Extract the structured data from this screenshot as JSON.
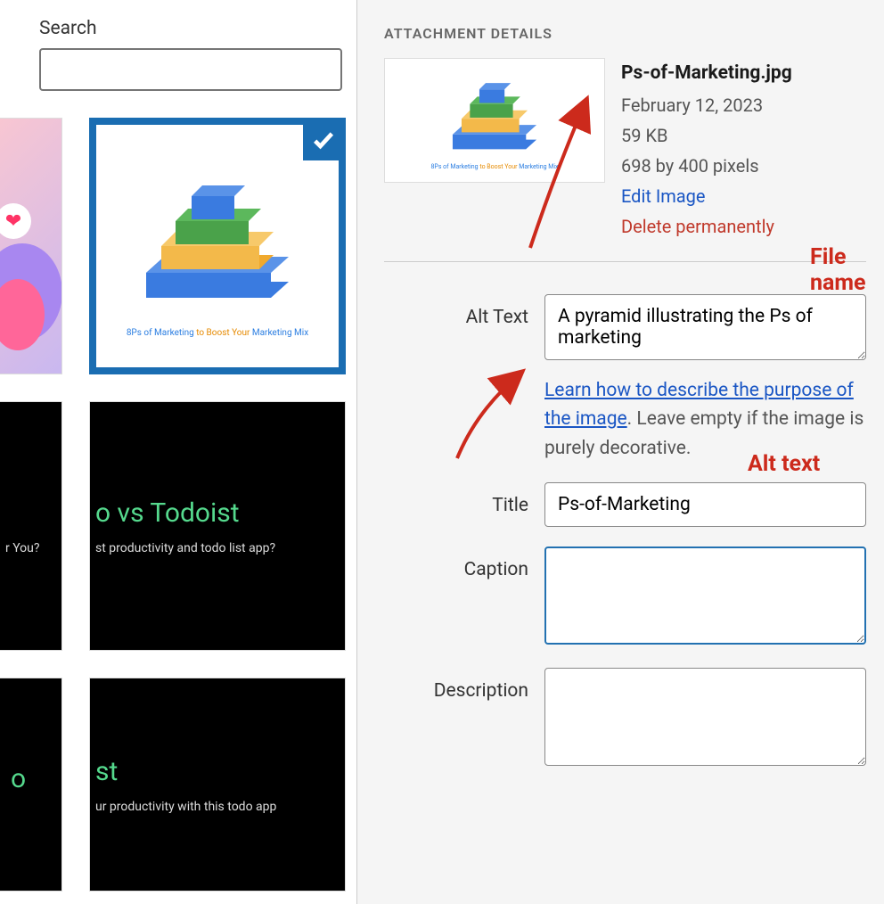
{
  "search": {
    "label": "Search",
    "value": ""
  },
  "thumbs": {
    "selected_caption_1": "8Ps of Marketing ",
    "selected_caption_2": "to Boost Your ",
    "selected_caption_3": "Marketing Mix",
    "row2_left_tail": "r You?",
    "row2_right_title": "o vs Todoist",
    "row2_right_sub": "st productivity and todo list app?",
    "row3_left_title": "o",
    "row3_right_title": "st",
    "row3_right_sub": "ur productivity with this todo app"
  },
  "panel": {
    "heading": "ATTACHMENT DETAILS",
    "filename": "Ps-of-Marketing.jpg",
    "date": "February 12, 2023",
    "size": "59 KB",
    "dimensions": "698 by 400 pixels",
    "edit": "Edit Image",
    "delete": "Delete permanently"
  },
  "form": {
    "alt_label": "Alt Text",
    "alt_value": "A pyramid illustrating the Ps of marketing",
    "alt_help_link": "Learn how to describe the purpose of the image",
    "alt_help_rest": ". Leave empty if the image is purely decorative.",
    "title_label": "Title",
    "title_value": "Ps-of-Marketing",
    "caption_label": "Caption",
    "caption_value": "",
    "description_label": "Description",
    "description_value": ""
  },
  "annotations": {
    "filename": "File name",
    "alttext": "Alt text"
  }
}
